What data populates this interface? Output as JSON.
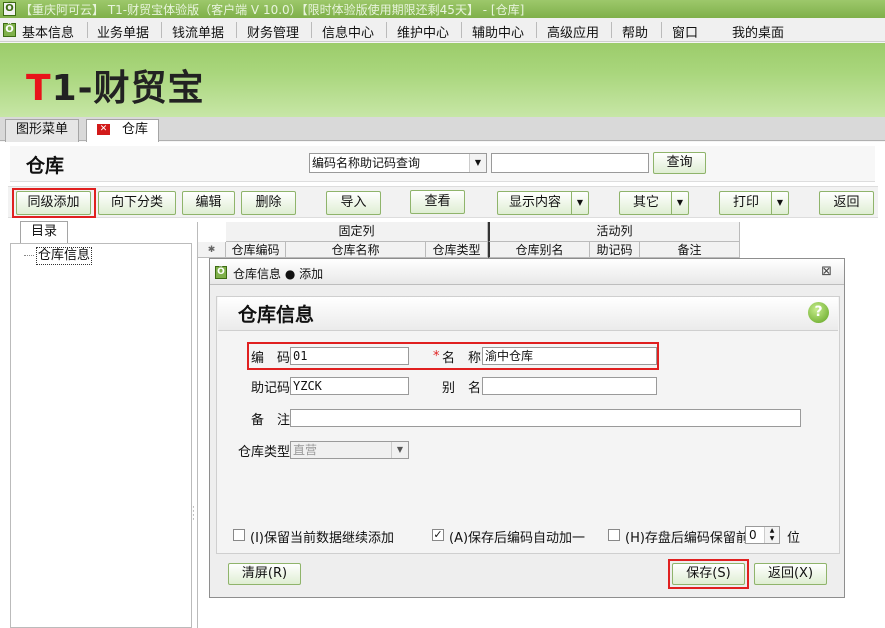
{
  "window": {
    "title": "【重庆阿可云】 T1-财贸宝体验版（客户端 V 10.0）【限时体验版使用期限还剩45天】 - [仓库]"
  },
  "menu": [
    "基本信息",
    "业务单据",
    "钱流单据",
    "财务管理",
    "信息中心",
    "维护中心",
    "辅助中心",
    "高级应用",
    "帮助",
    "窗口",
    "我的桌面"
  ],
  "banner": {
    "logo_t": "T",
    "logo_rest": "1-财贸宝"
  },
  "tabs": {
    "graphic_menu": "图形菜单",
    "warehouse": "仓库"
  },
  "page": {
    "title": "仓库",
    "query_select": "编码名称助记码查询",
    "query_input": "",
    "query_button": "查询"
  },
  "toolbar": {
    "same_level_add": "同级添加",
    "add_child": "向下分类",
    "edit": "编辑",
    "delete": "删除",
    "import": "导入",
    "view": "查看",
    "display": "显示内容",
    "other": "其它",
    "print": "打印",
    "back": "返回"
  },
  "tree": {
    "tab": "目录",
    "root": "仓库信息"
  },
  "grid": {
    "group_fixed": "固定列",
    "group_active": "活动列",
    "star": "✱",
    "columns": [
      "仓库编码",
      "仓库名称",
      "仓库类型",
      "仓库别名",
      "助记码",
      "备注"
    ]
  },
  "dialog": {
    "title": "仓库信息 ● 添加",
    "heading": "仓库信息",
    "fields": {
      "code_label": "编　码",
      "code_value": "01",
      "name_required": "*",
      "name_label": "名　称",
      "name_value": "渝中仓库",
      "mnemonic_label": "助记码",
      "mnemonic_value": "YZCK",
      "alias_label": "别　名",
      "alias_value": "",
      "remark_label": "备　注",
      "remark_value": "",
      "type_label": "仓库类型",
      "type_value": "直营"
    },
    "options": {
      "keep_data": "(I)保留当前数据继续添加",
      "keep_data_checked": false,
      "auto_increment": "(A)保存后编码自动加一",
      "auto_increment_checked": true,
      "keep_prefix": "(H)存盘后编码保留前",
      "keep_prefix_checked": false,
      "prefix_digits": "0",
      "digits_unit": "位"
    },
    "buttons": {
      "clear": "清屏(R)",
      "save": "保存(S)",
      "back": "返回(X)"
    }
  }
}
